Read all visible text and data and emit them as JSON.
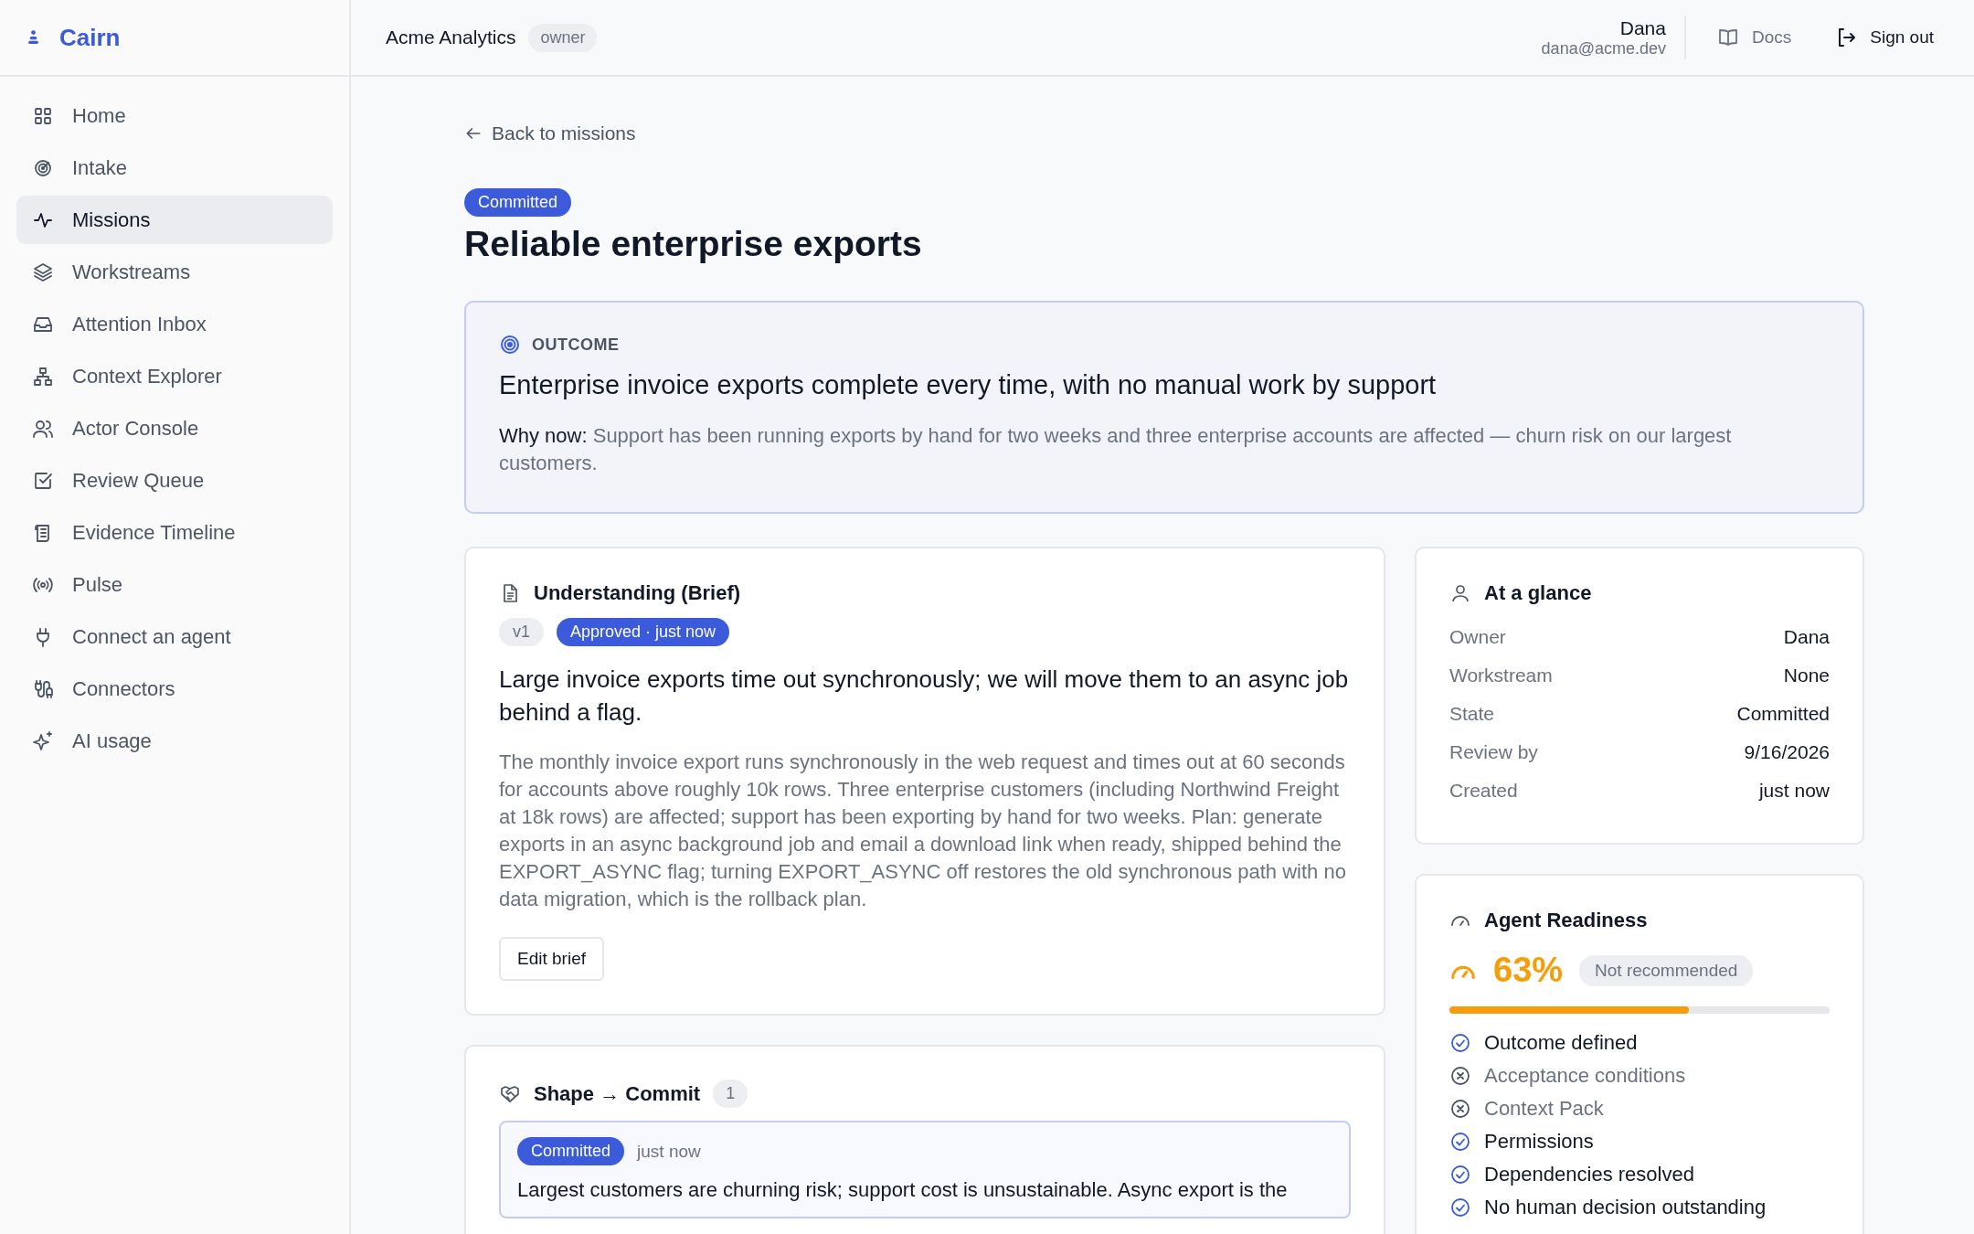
{
  "brand": {
    "name": "Cairn"
  },
  "sidebar": {
    "items": [
      {
        "label": "Home",
        "selected": false
      },
      {
        "label": "Intake",
        "selected": false
      },
      {
        "label": "Missions",
        "selected": true
      },
      {
        "label": "Workstreams",
        "selected": false
      },
      {
        "label": "Attention Inbox",
        "selected": false
      },
      {
        "label": "Context Explorer",
        "selected": false
      },
      {
        "label": "Actor Console",
        "selected": false
      },
      {
        "label": "Review Queue",
        "selected": false
      },
      {
        "label": "Evidence Timeline",
        "selected": false
      },
      {
        "label": "Pulse",
        "selected": false
      },
      {
        "label": "Connect an agent",
        "selected": false
      },
      {
        "label": "Connectors",
        "selected": false
      },
      {
        "label": "AI usage",
        "selected": false
      }
    ]
  },
  "header": {
    "workspace": "Acme Analytics",
    "role": "owner",
    "user_name": "Dana",
    "user_email": "dana@acme.dev",
    "docs": "Docs",
    "sign_out": "Sign out"
  },
  "back_link": "Back to missions",
  "mission": {
    "status": "Committed",
    "title": "Reliable enterprise exports"
  },
  "outcome": {
    "label": "OUTCOME",
    "statement": "Enterprise invoice exports complete every time, with no manual work by support",
    "why_now_label": "Why now:",
    "why_now": "Support has been running exports by hand for two weeks and three enterprise accounts are affected — churn risk on our largest customers."
  },
  "brief": {
    "title": "Understanding (Brief)",
    "version": "v1",
    "approval": "Approved · just now",
    "summary": "Large invoice exports time out synchronously; we will move them to an async job behind a flag.",
    "details": "The monthly invoice export runs synchronously in the web request and times out at 60 seconds for accounts above roughly 10k rows. Three enterprise customers (including Northwind Freight at 18k rows) are affected; support has been exporting by hand for two weeks. Plan: generate exports in an async background job and email a download link when ready, shipped behind the EXPORT_ASYNC flag; turning EXPORT_ASYNC off restores the old synchronous path with no data migration, which is the rollback plan.",
    "edit_button": "Edit brief"
  },
  "shape_commit": {
    "title": "Shape → Commit",
    "count": "1",
    "entries": [
      {
        "status": "Committed",
        "time": "just now",
        "text": "Largest customers are churning risk; support cost is unsustainable. Async export is the"
      }
    ]
  },
  "at_a_glance": {
    "title": "At a glance",
    "rows": [
      {
        "label": "Owner",
        "value": "Dana"
      },
      {
        "label": "Workstream",
        "value": "None"
      },
      {
        "label": "State",
        "value": "Committed"
      },
      {
        "label": "Review by",
        "value": "9/16/2026"
      },
      {
        "label": "Created",
        "value": "just now"
      }
    ]
  },
  "readiness": {
    "title": "Agent Readiness",
    "percent": "63%",
    "verdict": "Not recommended",
    "level": 0.63,
    "checks": [
      {
        "label": "Outcome defined",
        "done": true
      },
      {
        "label": "Acceptance conditions",
        "done": false
      },
      {
        "label": "Context Pack",
        "done": false
      },
      {
        "label": "Permissions",
        "done": true
      },
      {
        "label": "Dependencies resolved",
        "done": true
      },
      {
        "label": "No human decision outstanding",
        "done": true
      }
    ]
  }
}
